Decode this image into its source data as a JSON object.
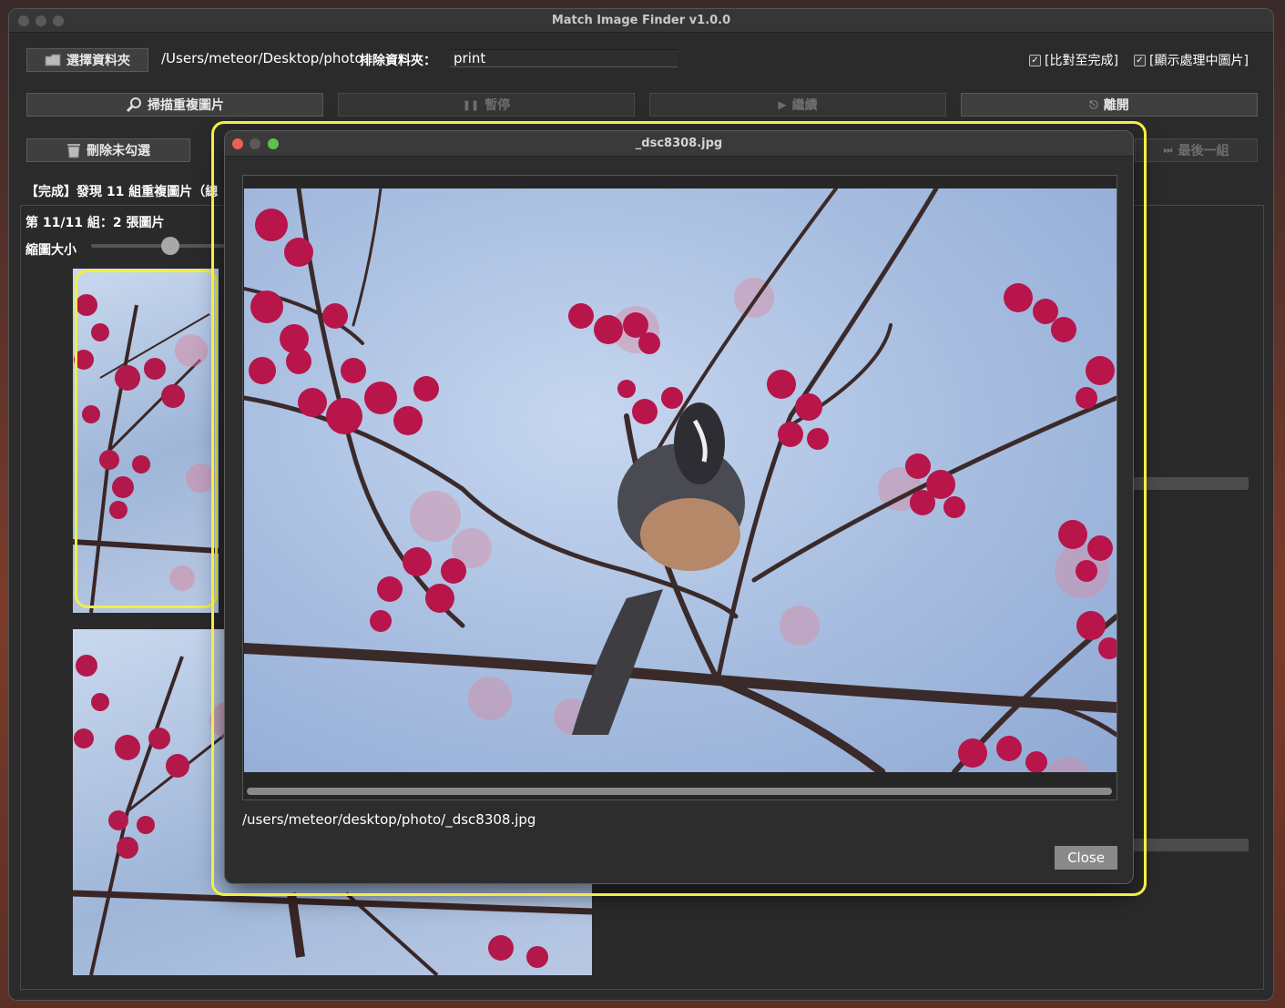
{
  "app": {
    "title": "Match Image Finder v1.0.0"
  },
  "toolbar": {
    "choose_folder_label": "選擇資料夾",
    "folder_path": "/Users/meteor/Desktop/photo",
    "exclude_label": "排除資料夾：",
    "exclude_value": "print",
    "compare_done_label": "[比對至完成]",
    "show_processing_label": "[顯示處理中圖片]",
    "scan_label": "掃描重複圖片",
    "pause_label": "暫停",
    "continue_label": "繼續",
    "leave_label": "離開",
    "delete_unchecked_label": "刪除未勾選",
    "last_group_label": "最後一組"
  },
  "status": {
    "text": "【完成】發現 11 組重複圖片（總"
  },
  "group": {
    "label": "第 11/11 組：2 張圖片",
    "thumb_size_label": "縮圖大小",
    "thumb_size_value": 0.58
  },
  "preview": {
    "title": "_dsc8308.jpg",
    "file_path": "/users/meteor/desktop/photo/_dsc8308.jpg",
    "close_label": "Close"
  },
  "icons": {
    "folder": "folder-icon",
    "scan": "magnifier-icon",
    "pause": "pause-icon",
    "play": "play-icon",
    "exit": "exit-icon",
    "trash": "trash-icon",
    "last": "skip-last-icon"
  },
  "colors": {
    "highlight": "#f2ee45",
    "close_red": "#ec5f57",
    "zoom_green": "#5ec14c"
  }
}
